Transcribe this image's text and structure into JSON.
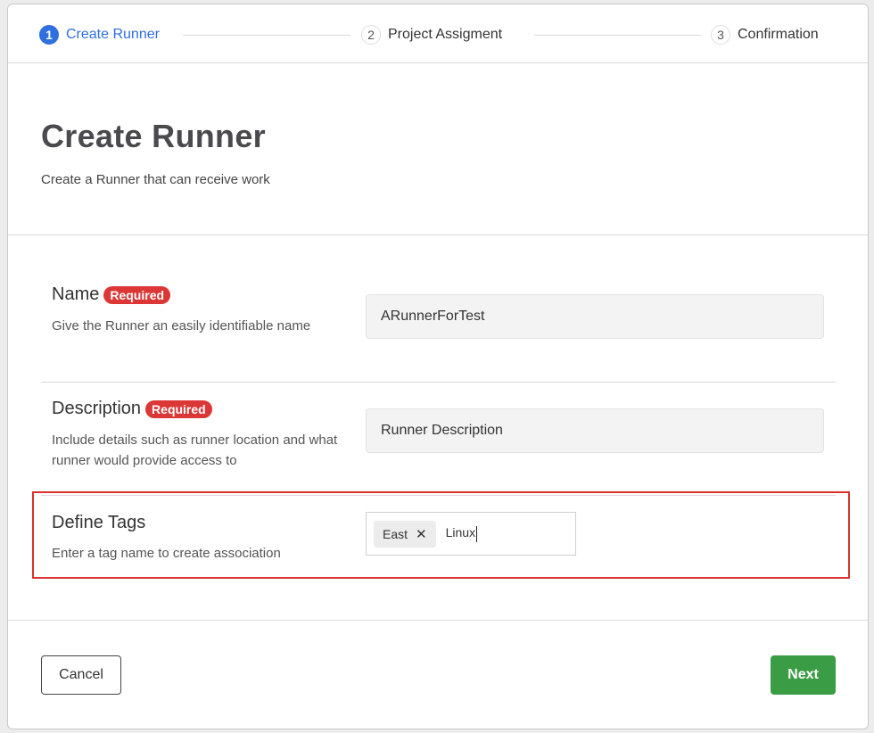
{
  "stepper": {
    "steps": [
      {
        "number": "1",
        "label": "Create Runner",
        "active": true
      },
      {
        "number": "2",
        "label": "Project Assigment",
        "active": false
      },
      {
        "number": "3",
        "label": "Confirmation",
        "active": false
      }
    ]
  },
  "header": {
    "title": "Create Runner",
    "subtitle": "Create a Runner that can receive work"
  },
  "form": {
    "name": {
      "label": "Name",
      "badge": "Required",
      "help": "Give the Runner an easily identifiable name",
      "value": "ARunnerForTest"
    },
    "description": {
      "label": "Description",
      "badge": "Required",
      "help": "Include details such as runner location and what runner would provide access to",
      "value": "Runner Description"
    },
    "tags": {
      "label": "Define Tags",
      "help": "Enter a tag name to create association",
      "chips": [
        "East"
      ],
      "chip_remove_glyph": "✕",
      "typed_value": "Linux"
    }
  },
  "footer": {
    "cancel_label": "Cancel",
    "next_label": "Next"
  },
  "colors": {
    "accent": "#2f6fde",
    "required": "#dc3737",
    "next": "#3a9d46",
    "highlight": "#d9322d"
  }
}
